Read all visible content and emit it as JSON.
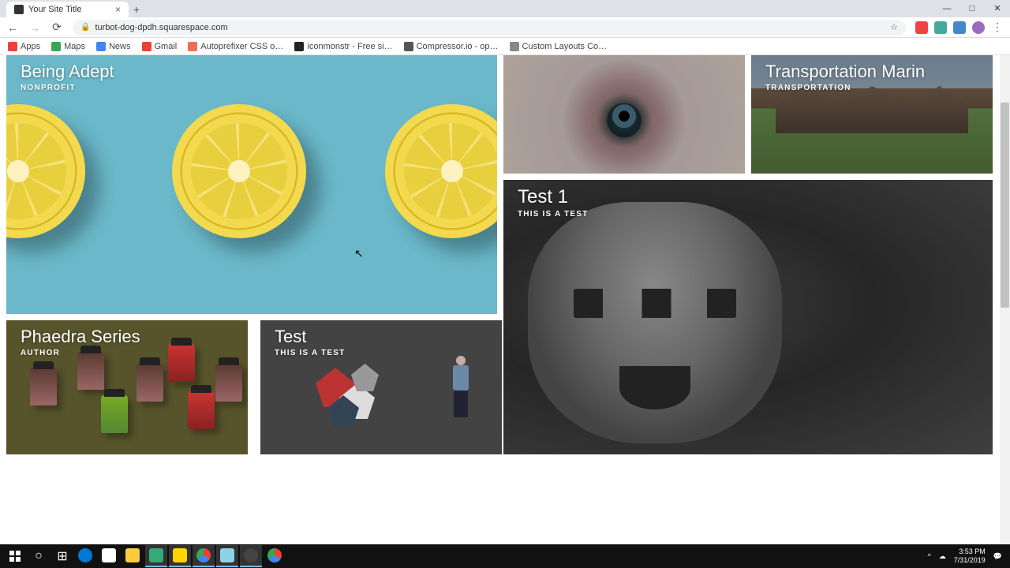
{
  "browser": {
    "tab_title": "Your Site Title",
    "url": "turbot-dog-dpdh.squarespace.com"
  },
  "bookmarks": [
    {
      "label": "Apps",
      "color": "#ea4335"
    },
    {
      "label": "Maps",
      "color": "#34a853"
    },
    {
      "label": "News",
      "color": "#4285f4"
    },
    {
      "label": "Gmail",
      "color": "#ea4335"
    },
    {
      "label": "Autoprefixer CSS o…",
      "color": "#ee6e55"
    },
    {
      "label": "iconmonstr - Free si…",
      "color": "#222"
    },
    {
      "label": "Compressor.io - op…",
      "color": "#555"
    },
    {
      "label": "Custom Layouts Co…",
      "color": "#888"
    }
  ],
  "cards": {
    "lemon": {
      "title": "Being Adept",
      "sub": "NONPROFIT"
    },
    "house": {
      "title": "Transportation Marin",
      "sub": "TRANSPORTATION"
    },
    "face": {
      "title": "Test 1",
      "sub": "THIS IS A TEST"
    },
    "jars": {
      "title": "Phaedra Series",
      "sub": "AUTHOR"
    },
    "test": {
      "title": "Test",
      "sub": "THIS IS A TEST"
    }
  },
  "taskbar": {
    "time": "3:53 PM",
    "date": "7/31/2019"
  }
}
